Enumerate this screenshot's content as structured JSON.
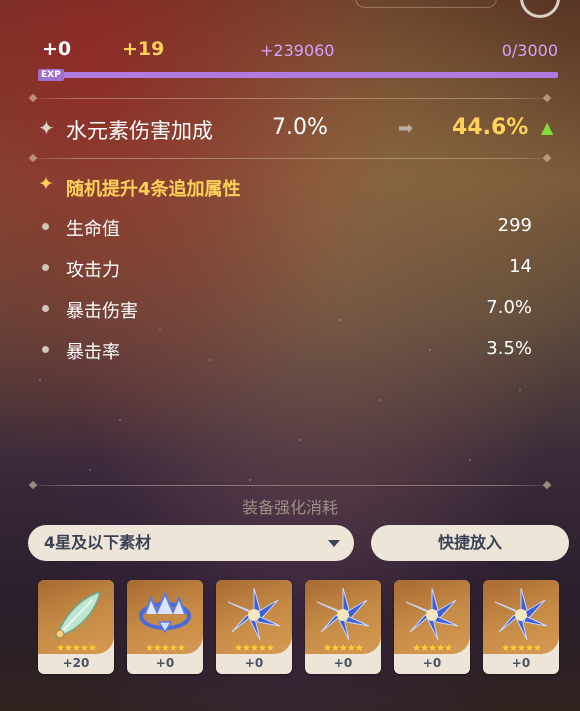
{
  "exp": {
    "base": "+0",
    "gain": "+19",
    "pending": "+239060",
    "progress": "0/3000",
    "tag": "EXP",
    "fill_fraction": 1.0
  },
  "main_stat": {
    "name": "水元素伤害加成",
    "from": "7.0%",
    "to": "44.6%"
  },
  "sub_stats": {
    "header": "随机提升4条追加属性",
    "items": [
      {
        "label": "生命值",
        "value": "299"
      },
      {
        "label": "攻击力",
        "value": "14"
      },
      {
        "label": "暴击伤害",
        "value": "7.0%"
      },
      {
        "label": "暴击率",
        "value": "3.5%"
      }
    ]
  },
  "consume": {
    "title": "装备强化消耗",
    "filter_selected": "4星及以下素材",
    "quick_button": "快捷放入",
    "slots": [
      {
        "icon": "feather-artifact-icon",
        "level": "+20",
        "stars": "★★★★★"
      },
      {
        "icon": "crown-circlet-artifact-icon",
        "level": "+0",
        "stars": "★★★★★"
      },
      {
        "icon": "blue-flower-artifact-icon",
        "level": "+0",
        "stars": "★★★★★"
      },
      {
        "icon": "blue-flower-artifact-icon",
        "level": "+0",
        "stars": "★★★★★"
      },
      {
        "icon": "blue-flower-artifact-icon",
        "level": "+0",
        "stars": "★★★★★"
      },
      {
        "icon": "blue-flower-artifact-icon",
        "level": "+0",
        "stars": "★★★★★"
      }
    ]
  },
  "colors": {
    "gold": "#ffd35a",
    "exp_purple": "#d6a2ff",
    "up_green": "#7de03a",
    "button_bg": "#ece5d8",
    "button_text": "#3b4255"
  }
}
